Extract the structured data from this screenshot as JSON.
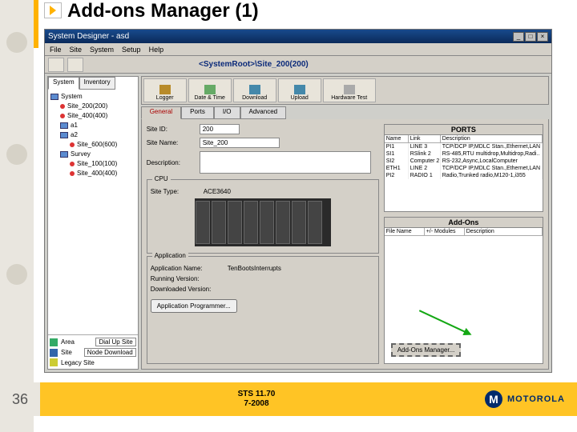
{
  "slide": {
    "title": "Add-ons Manager (1)",
    "page_number": "36",
    "footer_line1": "STS 11.70",
    "footer_line2": "7-2008",
    "brand": "MOTOROLA"
  },
  "app": {
    "window_title": "System Designer - asd",
    "menubar": [
      "File",
      "Site",
      "System",
      "Setup",
      "Help"
    ],
    "breadcrumb": "<SystemRoot>\\Site_200(200)",
    "left_tabs": [
      "System",
      "Inventory"
    ],
    "tree": {
      "root": "System",
      "children": [
        "Site_200(200)",
        "Site_400(400)",
        "a1",
        "a2",
        "Site_600(600)",
        "Survey",
        "Site_100(100)",
        "Site_400(400)"
      ]
    },
    "left_footer": [
      "Area",
      "Site",
      "Legacy Site"
    ],
    "left_actions": [
      "Dial Up Site",
      "Node Download"
    ],
    "center_toolbar": [
      "Logger",
      "Date & Time",
      "Download",
      "Upload",
      "Hardware Test"
    ],
    "center_tabs": [
      "General",
      "Ports",
      "I/O",
      "Advanced"
    ],
    "fields": {
      "site_id_label": "Site ID:",
      "site_id_value": "200",
      "site_name_label": "Site Name:",
      "site_name_value": "Site_200",
      "desc_label": "Description:",
      "desc_value": ""
    },
    "cpu_group": "CPU",
    "site_type_label": "Site Type:",
    "site_type_value": "ACE3640",
    "app_group": "Application",
    "app_name_label": "Application Name:",
    "app_name_value": "TenBootsInterrupts",
    "running_label": "Running Version:",
    "downloaded_label": "Downloaded Version:",
    "app_prog_btn": "Application Programmer...",
    "ports_panel": {
      "title": "PORTS",
      "cols": [
        "Name",
        "Link",
        "Description"
      ],
      "rows": [
        [
          "PI1",
          "LINE 3",
          "TCP/DCP IP,MDLC Stan.,Ethernet,LAN"
        ],
        [
          "SI1",
          "RSlink 2",
          "RS-485,RTU multidrop,Multidrop,Radi.."
        ],
        [
          "SI2",
          "Computer 2",
          "RS-232,Async,LocalComputer"
        ],
        [
          "ETH1",
          "LINE 2",
          "TCP/DCP IP,MDLC Stan.,Ethernet,LAN"
        ],
        [
          "PI2",
          "RADIO 1",
          "Radio,Trunked radio,M120-1,i355"
        ]
      ]
    },
    "addons_panel": {
      "title": "Add-Ons",
      "cols": [
        "File Name",
        "+/- Modules",
        "Description"
      ]
    },
    "addons_btn": "Add-Ons Manager..."
  }
}
